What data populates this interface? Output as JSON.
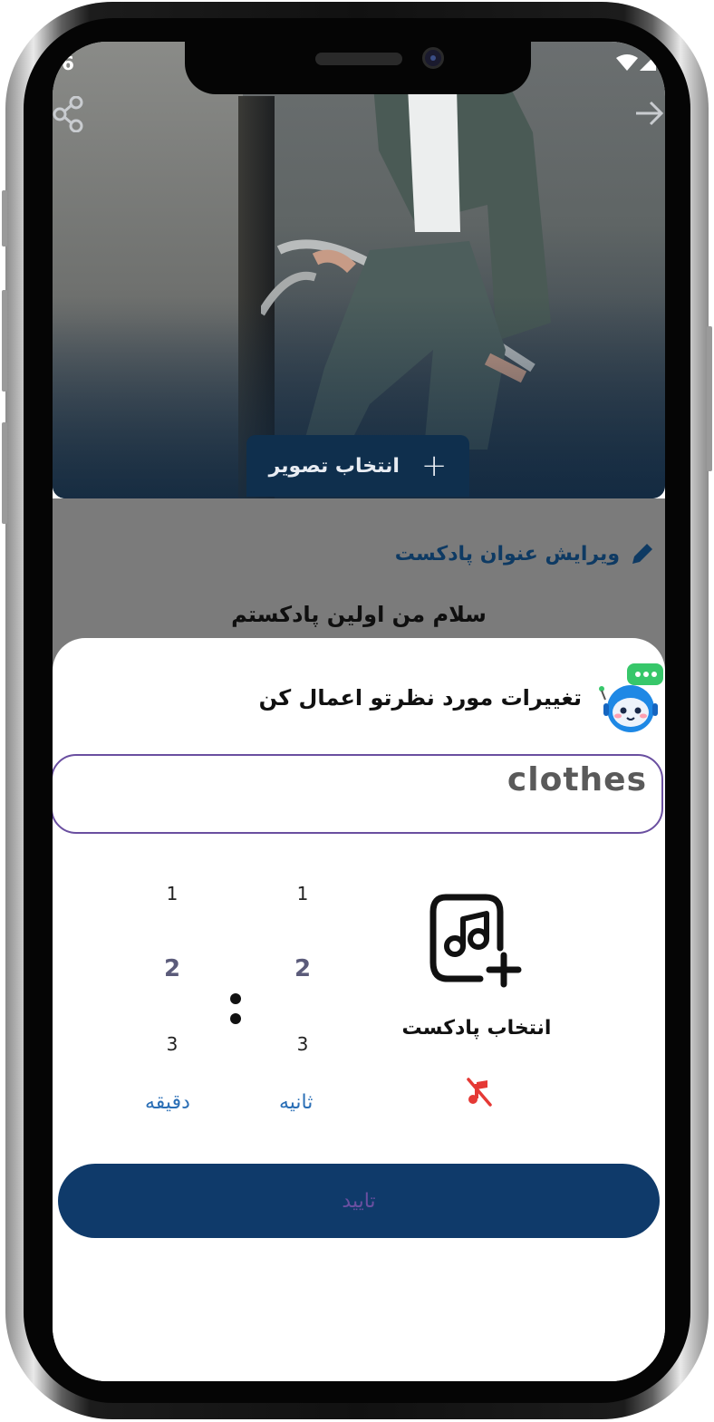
{
  "status": {
    "time": "6"
  },
  "hero": {
    "pick_image_label": "انتخاب تصویر",
    "plus_symbol": "+"
  },
  "podcast": {
    "edit_title_label": "ویرایش عنوان پادکست",
    "title_value": "سلام من اولین پادکستم"
  },
  "sheet": {
    "title": "تغییرات مورد نظرتو اعمال کن",
    "text_field_value": "clothes",
    "seconds_picker": {
      "items": [
        "1",
        "2",
        "3"
      ],
      "selected": "2",
      "unit_label": "ثانیه"
    },
    "minutes_picker": {
      "items": [
        "1",
        "2",
        "3"
      ],
      "selected": "2",
      "unit_label": "دقیقه"
    },
    "podcast_pick_label": "انتخاب پادکست",
    "confirm_label": "تایید"
  },
  "colors": {
    "primary": "#0f3a6a",
    "accent_purple": "#6a4fa0",
    "link_blue": "#2b6fb6",
    "danger": "#e53935"
  },
  "icons": [
    "share-icon",
    "arrow-forward-icon",
    "plus-icon",
    "pencil-icon",
    "robot-chat-icon",
    "music-add-icon",
    "music-off-icon",
    "wifi-icon",
    "signal-icon"
  ]
}
